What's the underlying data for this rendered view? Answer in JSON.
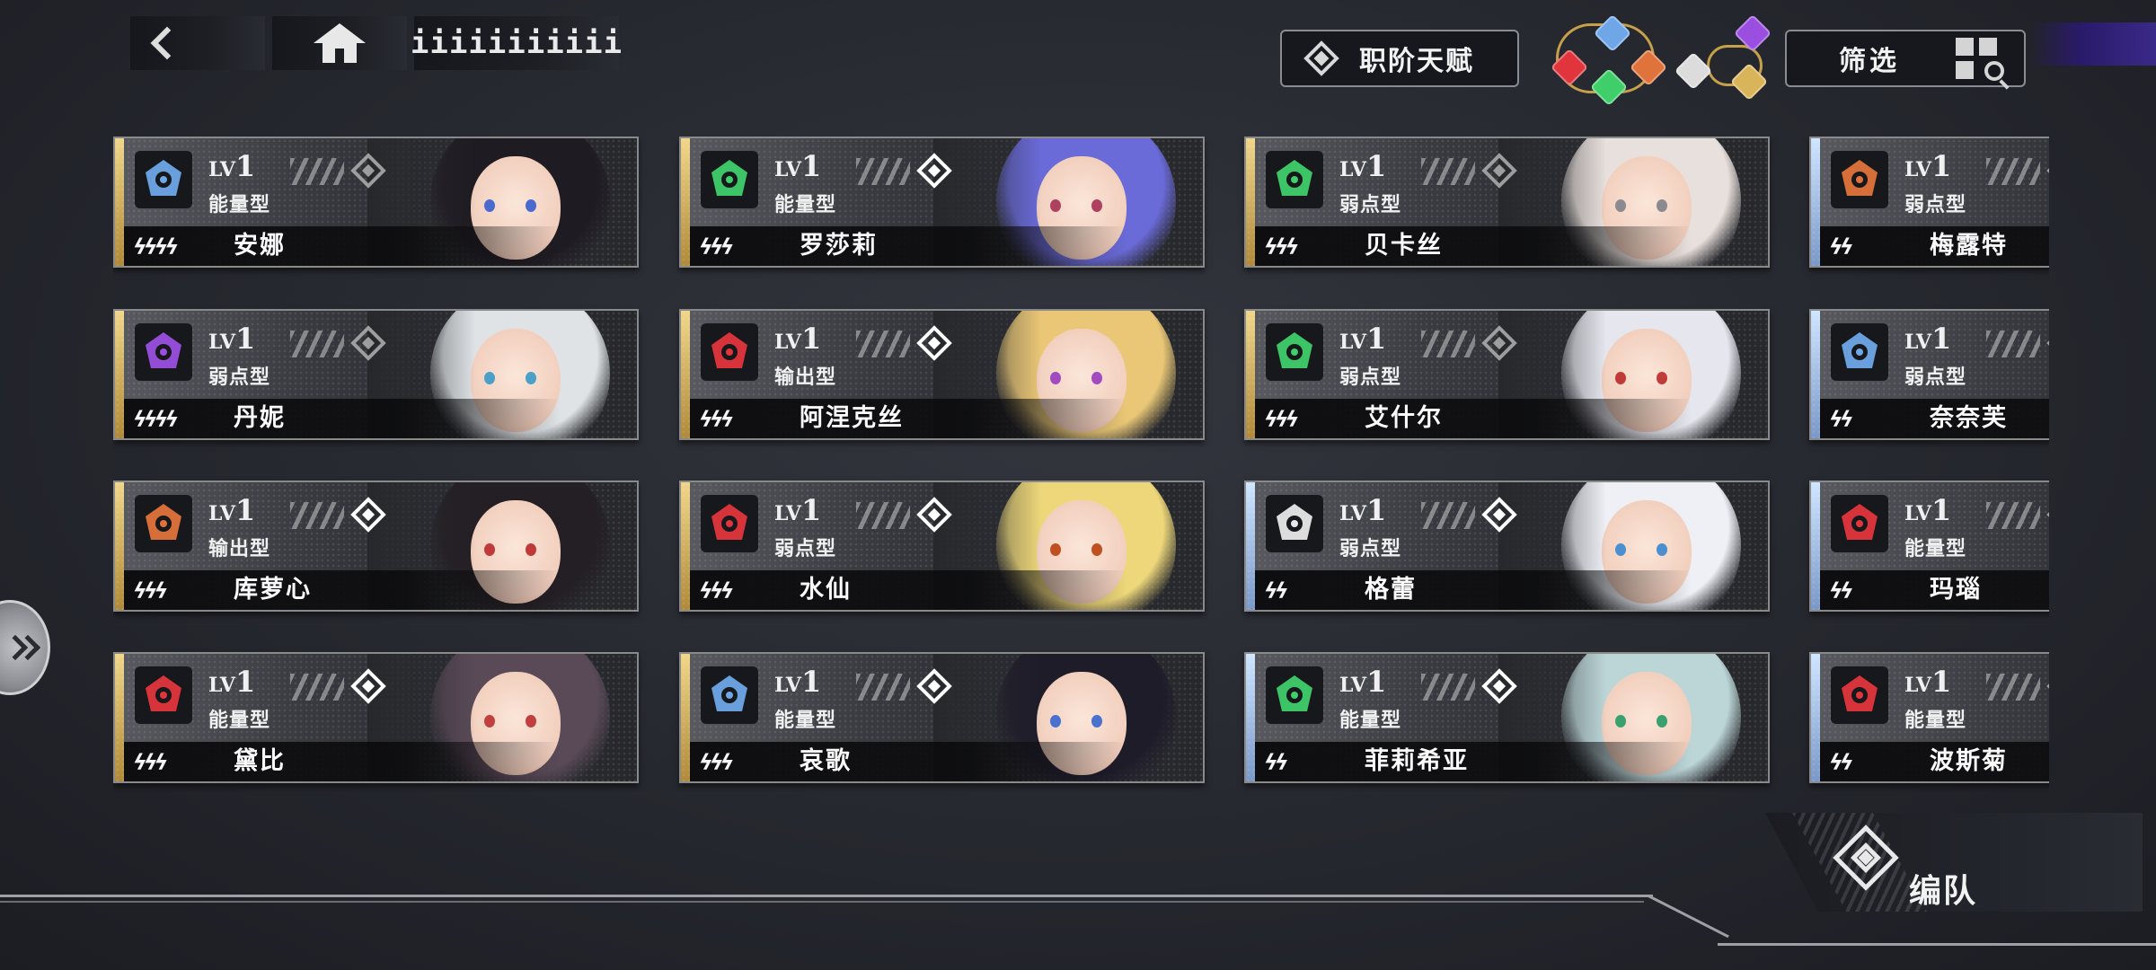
{
  "topbar": {
    "mode_label": "iiiiiiiiiii",
    "talent_label": "职阶天赋",
    "filter_label": "筛选"
  },
  "colors": {
    "blue": "#6ea6e8",
    "green": "#3fce6a",
    "red": "#e0353d",
    "orange": "#e0733c",
    "purple": "#9a4fe0",
    "white": "#e8e8e8",
    "gold": "#d9b45a"
  },
  "element_filters": [
    {
      "name": "blue-element-icon",
      "color": "#6ea6e8"
    },
    {
      "name": "red-element-icon",
      "color": "#e0353d"
    },
    {
      "name": "orange-element-icon",
      "color": "#e0733c"
    },
    {
      "name": "green-element-icon",
      "color": "#3fce6a"
    },
    {
      "name": "white-element-icon",
      "color": "#dcdcdc"
    },
    {
      "name": "purple-element-icon",
      "color": "#9a4fe0"
    },
    {
      "name": "gold-element-icon",
      "color": "#d9b45a"
    }
  ],
  "cards": [
    {
      "name": "安娜",
      "role": "能量型",
      "lv": "1",
      "stars": "ϟϟϟϟ",
      "element": "blue",
      "dia": "dim",
      "strip": "gold",
      "hair": "#1f1b22",
      "eye": "#4a6ad0"
    },
    {
      "name": "罗莎莉",
      "role": "能量型",
      "lv": "1",
      "stars": "ϟϟϟ",
      "element": "green",
      "dia": "bright",
      "strip": "gold",
      "hair": "#6a6ad8",
      "eye": "#b04060"
    },
    {
      "name": "贝卡丝",
      "role": "弱点型",
      "lv": "1",
      "stars": "ϟϟϟ",
      "element": "green",
      "dia": "dim",
      "strip": "gold",
      "hair": "#e8e0dc",
      "eye": "#8a8a90"
    },
    {
      "name": "梅露特",
      "role": "弱点型",
      "lv": "1",
      "stars": "ϟϟ",
      "element": "orange",
      "dia": "dim",
      "strip": "blue",
      "hair": "#2a2a2e",
      "eye": "#555"
    },
    {
      "name": "丹妮",
      "role": "弱点型",
      "lv": "1",
      "stars": "ϟϟϟϟ",
      "element": "purple",
      "dia": "dim",
      "strip": "gold",
      "hair": "#dfe3e6",
      "eye": "#4aa0c8"
    },
    {
      "name": "阿涅克丝",
      "role": "输出型",
      "lv": "1",
      "stars": "ϟϟϟ",
      "element": "red",
      "dia": "bright",
      "strip": "gold",
      "hair": "#e9c776",
      "eye": "#a24ac0"
    },
    {
      "name": "艾什尔",
      "role": "弱点型",
      "lv": "1",
      "stars": "ϟϟϟ",
      "element": "green",
      "dia": "dim",
      "strip": "gold",
      "hair": "#e6e6ee",
      "eye": "#c03a3a"
    },
    {
      "name": "奈奈芙",
      "role": "弱点型",
      "lv": "1",
      "stars": "ϟϟ",
      "element": "blue",
      "dia": "dim",
      "strip": "blue",
      "hair": "#2a2a2e",
      "eye": "#555"
    },
    {
      "name": "库萝心",
      "role": "输出型",
      "lv": "1",
      "stars": "ϟϟϟ",
      "element": "orange",
      "dia": "bright",
      "strip": "gold",
      "hair": "#241f24",
      "eye": "#c03a3a"
    },
    {
      "name": "水仙",
      "role": "弱点型",
      "lv": "1",
      "stars": "ϟϟϟ",
      "element": "red",
      "dia": "bright",
      "strip": "gold",
      "hair": "#edd77a",
      "eye": "#c05020"
    },
    {
      "name": "格蕾",
      "role": "弱点型",
      "lv": "1",
      "stars": "ϟϟ",
      "element": "white",
      "dia": "bright",
      "strip": "blue",
      "hair": "#eef0f6",
      "eye": "#4a90d0"
    },
    {
      "name": "玛瑙",
      "role": "能量型",
      "lv": "1",
      "stars": "ϟϟ",
      "element": "red",
      "dia": "dim",
      "strip": "blue",
      "hair": "#2a2a2e",
      "eye": "#555"
    },
    {
      "name": "黛比",
      "role": "能量型",
      "lv": "1",
      "stars": "ϟϟϟ",
      "element": "red",
      "dia": "bright",
      "strip": "gold",
      "hair": "#5a4a58",
      "eye": "#c04040"
    },
    {
      "name": "哀歌",
      "role": "能量型",
      "lv": "1",
      "stars": "ϟϟϟ",
      "element": "blue",
      "dia": "bright",
      "strip": "gold",
      "hair": "#1f1c2a",
      "eye": "#4a70d0"
    },
    {
      "name": "菲莉希亚",
      "role": "能量型",
      "lv": "1",
      "stars": "ϟϟ",
      "element": "green",
      "dia": "bright",
      "strip": "blue",
      "hair": "#bcd6d8",
      "eye": "#3aa070"
    },
    {
      "name": "波斯菊",
      "role": "能量型",
      "lv": "1",
      "stars": "ϟϟ",
      "element": "red",
      "dia": "dim",
      "strip": "blue",
      "hair": "#2a2a2e",
      "eye": "#555"
    }
  ],
  "formation_label": "编队"
}
